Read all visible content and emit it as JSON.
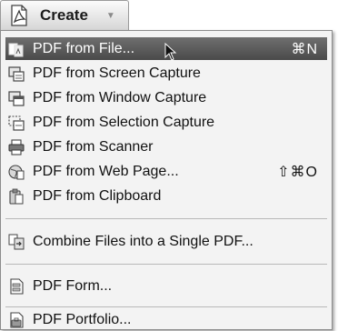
{
  "create_button": {
    "label": "Create",
    "arrow": "▼",
    "icon": "create-pdf-icon"
  },
  "menu": {
    "items": [
      {
        "label": "PDF from File...",
        "shortcut": "⌘N",
        "icon": "file-to-pdf-icon",
        "highlighted": true
      },
      {
        "label": "PDF from Screen Capture",
        "shortcut": "",
        "icon": "screen-capture-icon"
      },
      {
        "label": "PDF from Window Capture",
        "shortcut": "",
        "icon": "window-capture-icon"
      },
      {
        "label": "PDF from Selection Capture",
        "shortcut": "",
        "icon": "selection-capture-icon"
      },
      {
        "label": "PDF from Scanner",
        "shortcut": "",
        "icon": "scanner-icon"
      },
      {
        "label": "PDF from Web Page...",
        "shortcut": "⇧⌘O",
        "icon": "web-page-icon"
      },
      {
        "label": "PDF from Clipboard",
        "shortcut": "",
        "icon": "clipboard-icon"
      },
      {
        "label": "Combine Files into a Single PDF...",
        "shortcut": "",
        "icon": "combine-files-icon"
      },
      {
        "label": "PDF Form...",
        "shortcut": "",
        "icon": "pdf-form-icon"
      },
      {
        "label": "PDF Portfolio...",
        "shortcut": "",
        "icon": "pdf-portfolio-icon"
      }
    ]
  },
  "colors": {
    "highlight": "#5c5c5c",
    "menu_background": "#f3f3f3"
  }
}
